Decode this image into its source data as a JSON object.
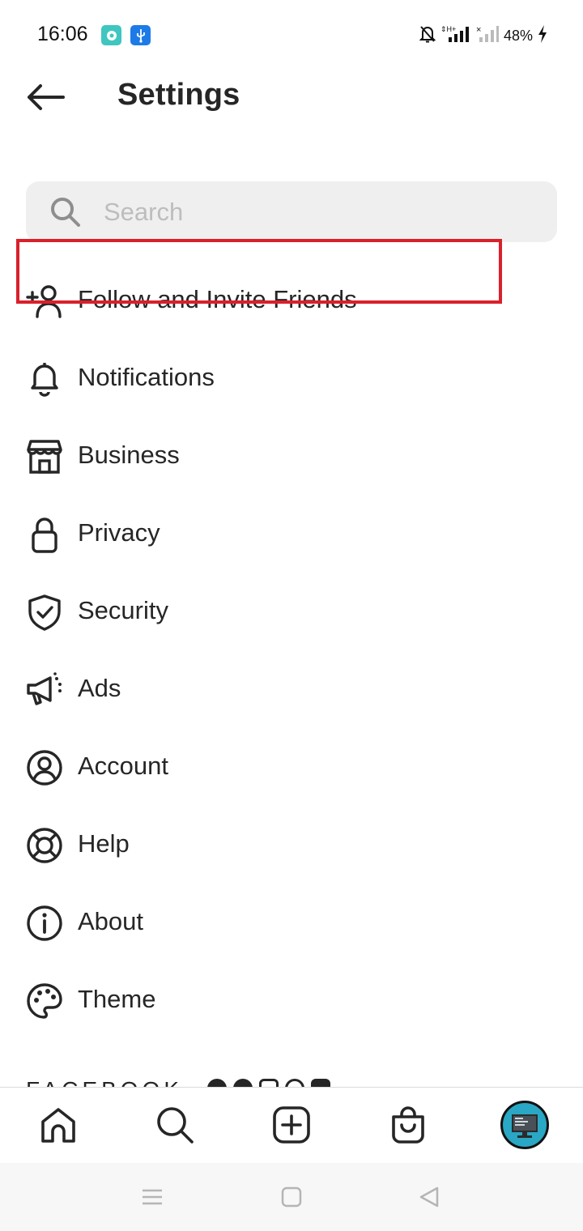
{
  "status_bar": {
    "time": "16:06",
    "battery": "48%",
    "icons": [
      "lens-app-icon",
      "usb-icon",
      "bell-off-icon",
      "signal-icon",
      "signal-empty-icon",
      "charging-icon"
    ]
  },
  "header": {
    "title": "Settings",
    "back_icon": "arrow-left-icon"
  },
  "search": {
    "placeholder": "Search",
    "value": ""
  },
  "menu": {
    "items": [
      {
        "label": "Follow and Invite Friends",
        "icon": "add-person-icon"
      },
      {
        "label": "Notifications",
        "icon": "bell-icon"
      },
      {
        "label": "Business",
        "icon": "shop-icon"
      },
      {
        "label": "Privacy",
        "icon": "lock-icon"
      },
      {
        "label": "Security",
        "icon": "shield-check-icon"
      },
      {
        "label": "Ads",
        "icon": "megaphone-icon"
      },
      {
        "label": "Account",
        "icon": "person-circle-icon"
      },
      {
        "label": "Help",
        "icon": "lifebuoy-icon"
      },
      {
        "label": "About",
        "icon": "info-icon"
      },
      {
        "label": "Theme",
        "icon": "palette-icon"
      }
    ],
    "highlighted": "Privacy"
  },
  "footer": {
    "brand": "FACEBOOK"
  },
  "bottom_nav": {
    "items": [
      "home-icon",
      "search-icon",
      "create-post-icon",
      "shop-bag-icon",
      "profile-avatar"
    ]
  },
  "system_nav": [
    "recents-icon",
    "home-square-icon",
    "back-triangle-icon"
  ],
  "colors": {
    "highlight": "#d9202b",
    "text": "#262626",
    "search_bg": "#efefef",
    "avatar_bg": "#29a7c4"
  }
}
